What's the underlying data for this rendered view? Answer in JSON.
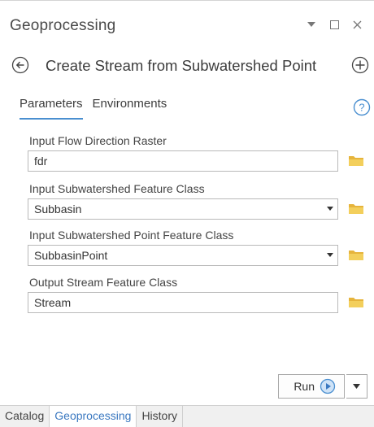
{
  "window": {
    "title": "Geoprocessing"
  },
  "tool": {
    "name": "Create Stream from Subwatershed Point"
  },
  "tabs": {
    "parameters": "Parameters",
    "environments": "Environments"
  },
  "fields": [
    {
      "label": "Input Flow Direction Raster",
      "value": "fdr",
      "type": "text"
    },
    {
      "label": "Input Subwatershed Feature Class",
      "value": "Subbasin",
      "type": "dropdown"
    },
    {
      "label": "Input Subwatershed Point Feature Class",
      "value": "SubbasinPoint",
      "type": "dropdown"
    },
    {
      "label": "Output Stream Feature Class",
      "value": "Stream",
      "type": "text"
    }
  ],
  "run": {
    "label": "Run"
  },
  "bottom_tabs": [
    "Catalog",
    "Geoprocessing",
    "History"
  ],
  "colors": {
    "accent": "#4a8fd0",
    "folder": "#f0c24a",
    "active_tab_text": "#3a78c0"
  },
  "icons": {
    "back": "back-arrow-icon",
    "add": "plus-circle-icon",
    "help": "help-icon",
    "folder": "folder-icon",
    "run": "play-icon"
  }
}
